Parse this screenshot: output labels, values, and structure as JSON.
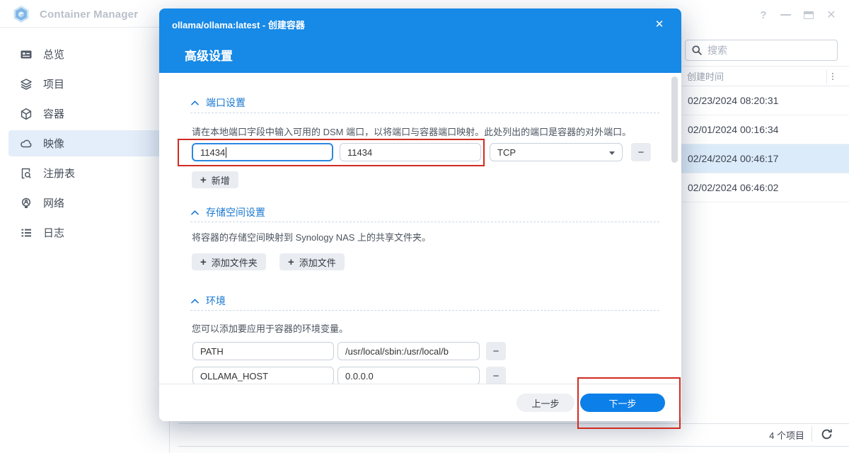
{
  "window": {
    "title": "Container Manager",
    "help_label": "?"
  },
  "sidebar": {
    "items": [
      {
        "label": "总览",
        "icon": "overview-icon",
        "active": false
      },
      {
        "label": "项目",
        "icon": "project-icon",
        "active": false
      },
      {
        "label": "容器",
        "icon": "container-icon",
        "active": false
      },
      {
        "label": "映像",
        "icon": "image-icon",
        "active": true
      },
      {
        "label": "注册表",
        "icon": "registry-icon",
        "active": false
      },
      {
        "label": "网络",
        "icon": "network-icon",
        "active": false
      },
      {
        "label": "日志",
        "icon": "log-icon",
        "active": false
      }
    ]
  },
  "modal": {
    "title": "ollama/ollama:latest - 创建容器",
    "subtitle": "高级设置",
    "sections": {
      "ports": {
        "title": "端口设置",
        "description": "请在本地端口字段中输入可用的 DSM 端口，以将端口与容器端口映射。此处列出的端口是容器的对外端口。",
        "rows": [
          {
            "local_port": "11434",
            "container_port": "11434",
            "protocol": "TCP"
          }
        ],
        "add_label": "新增"
      },
      "storage": {
        "title": "存储空间设置",
        "description": "将容器的存储空间映射到 Synology NAS 上的共享文件夹。",
        "add_folder_label": "添加文件夹",
        "add_file_label": "添加文件"
      },
      "environment": {
        "title": "环境",
        "description": "您可以添加要应用于容器的环境变量。",
        "variables": [
          {
            "name": "PATH",
            "value": "/usr/local/sbin:/usr/local/b"
          },
          {
            "name": "OLLAMA_HOST",
            "value": "0.0.0.0"
          }
        ]
      }
    },
    "footer": {
      "back_label": "上一步",
      "next_label": "下一步"
    }
  },
  "panel": {
    "search_placeholder": "搜索",
    "column_header": "创建时间",
    "rows": [
      {
        "created": "02/23/2024 08:20:31",
        "selected": false
      },
      {
        "created": "02/01/2024 00:16:34",
        "selected": false
      },
      {
        "created": "02/24/2024 00:46:17",
        "selected": true
      },
      {
        "created": "02/02/2024 06:46:02",
        "selected": false
      }
    ],
    "status": {
      "item_count_label": "4 个项目"
    }
  },
  "colors": {
    "header_blue": "#1789e6",
    "primary_blue": "#0d7fe8",
    "section_title_blue": "#1a78d2",
    "sidebar_active_bg": "#e4eefa",
    "selected_row_bg": "#dcebf9",
    "annotation_red": "#d02b20"
  }
}
